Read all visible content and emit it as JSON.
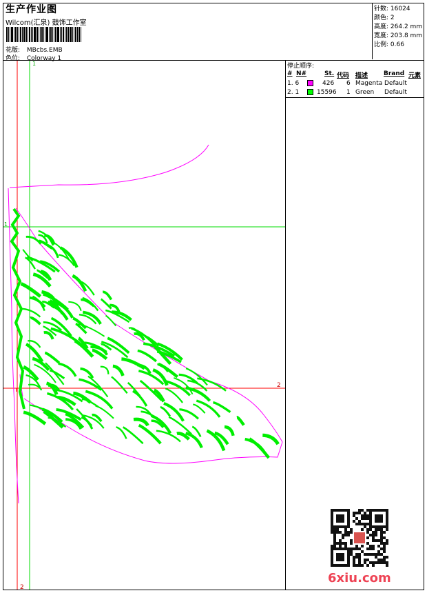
{
  "header": {
    "title": "生产作业图",
    "company": "Wilcom(汇泉) 鼓饰工作室",
    "design_label": "花版:",
    "design_value": "MBcbs.EMB",
    "colorway_label": "色位:",
    "colorway_value": "Colorway 1"
  },
  "specs": [
    {
      "label": "针数:",
      "value": "16024"
    },
    {
      "label": "颜色:",
      "value": "2"
    },
    {
      "label": "高度:",
      "value": "264.2 mm"
    },
    {
      "label": "宽度:",
      "value": "203.8 mm"
    },
    {
      "label": "比例:",
      "value": "0.66"
    }
  ],
  "stop_sequence": {
    "heading": "停止顺序:",
    "columns": [
      "#",
      "N#",
      "St.",
      "代码",
      "描述",
      "Brand",
      "元素"
    ],
    "rows": [
      {
        "num": "1.",
        "n": "6",
        "color": "#ff00ff",
        "stitches": "426",
        "code": "6",
        "desc": "Magenta",
        "brand": "Default"
      },
      {
        "num": "2.",
        "n": "1",
        "color": "#00ff00",
        "stitches": "15596",
        "code": "1",
        "desc": "Green",
        "brand": "Default"
      }
    ]
  },
  "guides": {
    "v_green_label": "1",
    "h_green_label": "1",
    "h_red_label": "2",
    "v_red_label": "2"
  },
  "watermark": "6xiu.com"
}
